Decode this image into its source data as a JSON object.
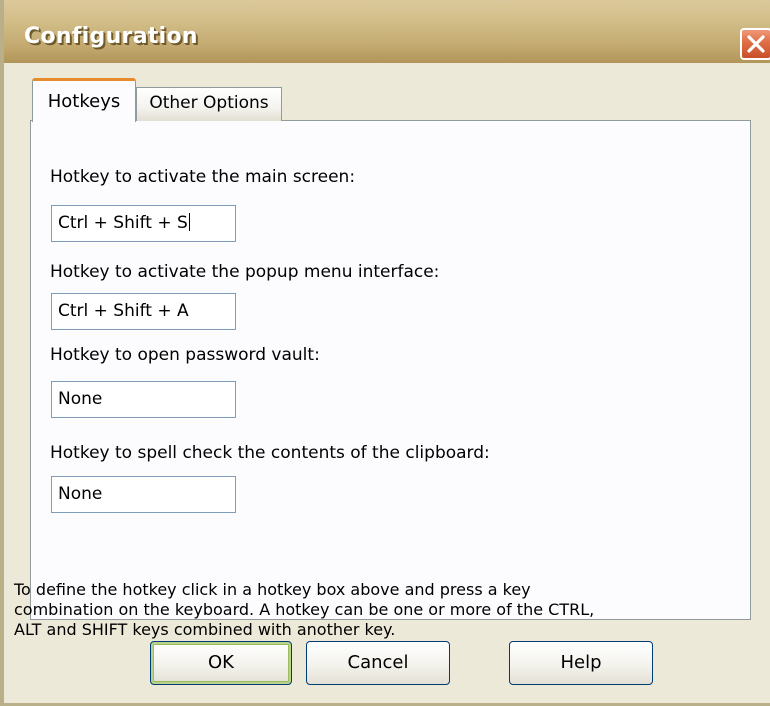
{
  "window": {
    "title": "Configuration",
    "close_icon": "close-x-icon",
    "colors": {
      "titlebar": "#c7ae74",
      "close_button": "#de6d45",
      "active_tab_accent": "#e68b2c",
      "dialog_background": "#ece9d8",
      "field_border": "#7f9db9"
    }
  },
  "tabs": [
    {
      "label": "Hotkeys",
      "selected": true
    },
    {
      "label": "Other Options",
      "selected": false
    }
  ],
  "hotkeys": {
    "main_screen": {
      "label": "Hotkey to activate the main screen:",
      "value": "Ctrl + Shift + S"
    },
    "popup_menu": {
      "label": "Hotkey to activate the popup menu interface:",
      "value": "Ctrl + Shift + A"
    },
    "password_vault": {
      "label": "Hotkey to open password vault:",
      "value": "None"
    },
    "spell_check": {
      "label": "Hotkey to spell check the contents of the clipboard:",
      "value": "None"
    }
  },
  "instructions": [
    "To define the hotkey click in a hotkey box above and press a key",
    "combination on the keyboard.  A hotkey can be one or more of the CTRL,",
    "ALT and SHIFT keys combined with another key."
  ],
  "buttons": {
    "ok": "OK",
    "cancel": "Cancel",
    "help": "Help"
  }
}
